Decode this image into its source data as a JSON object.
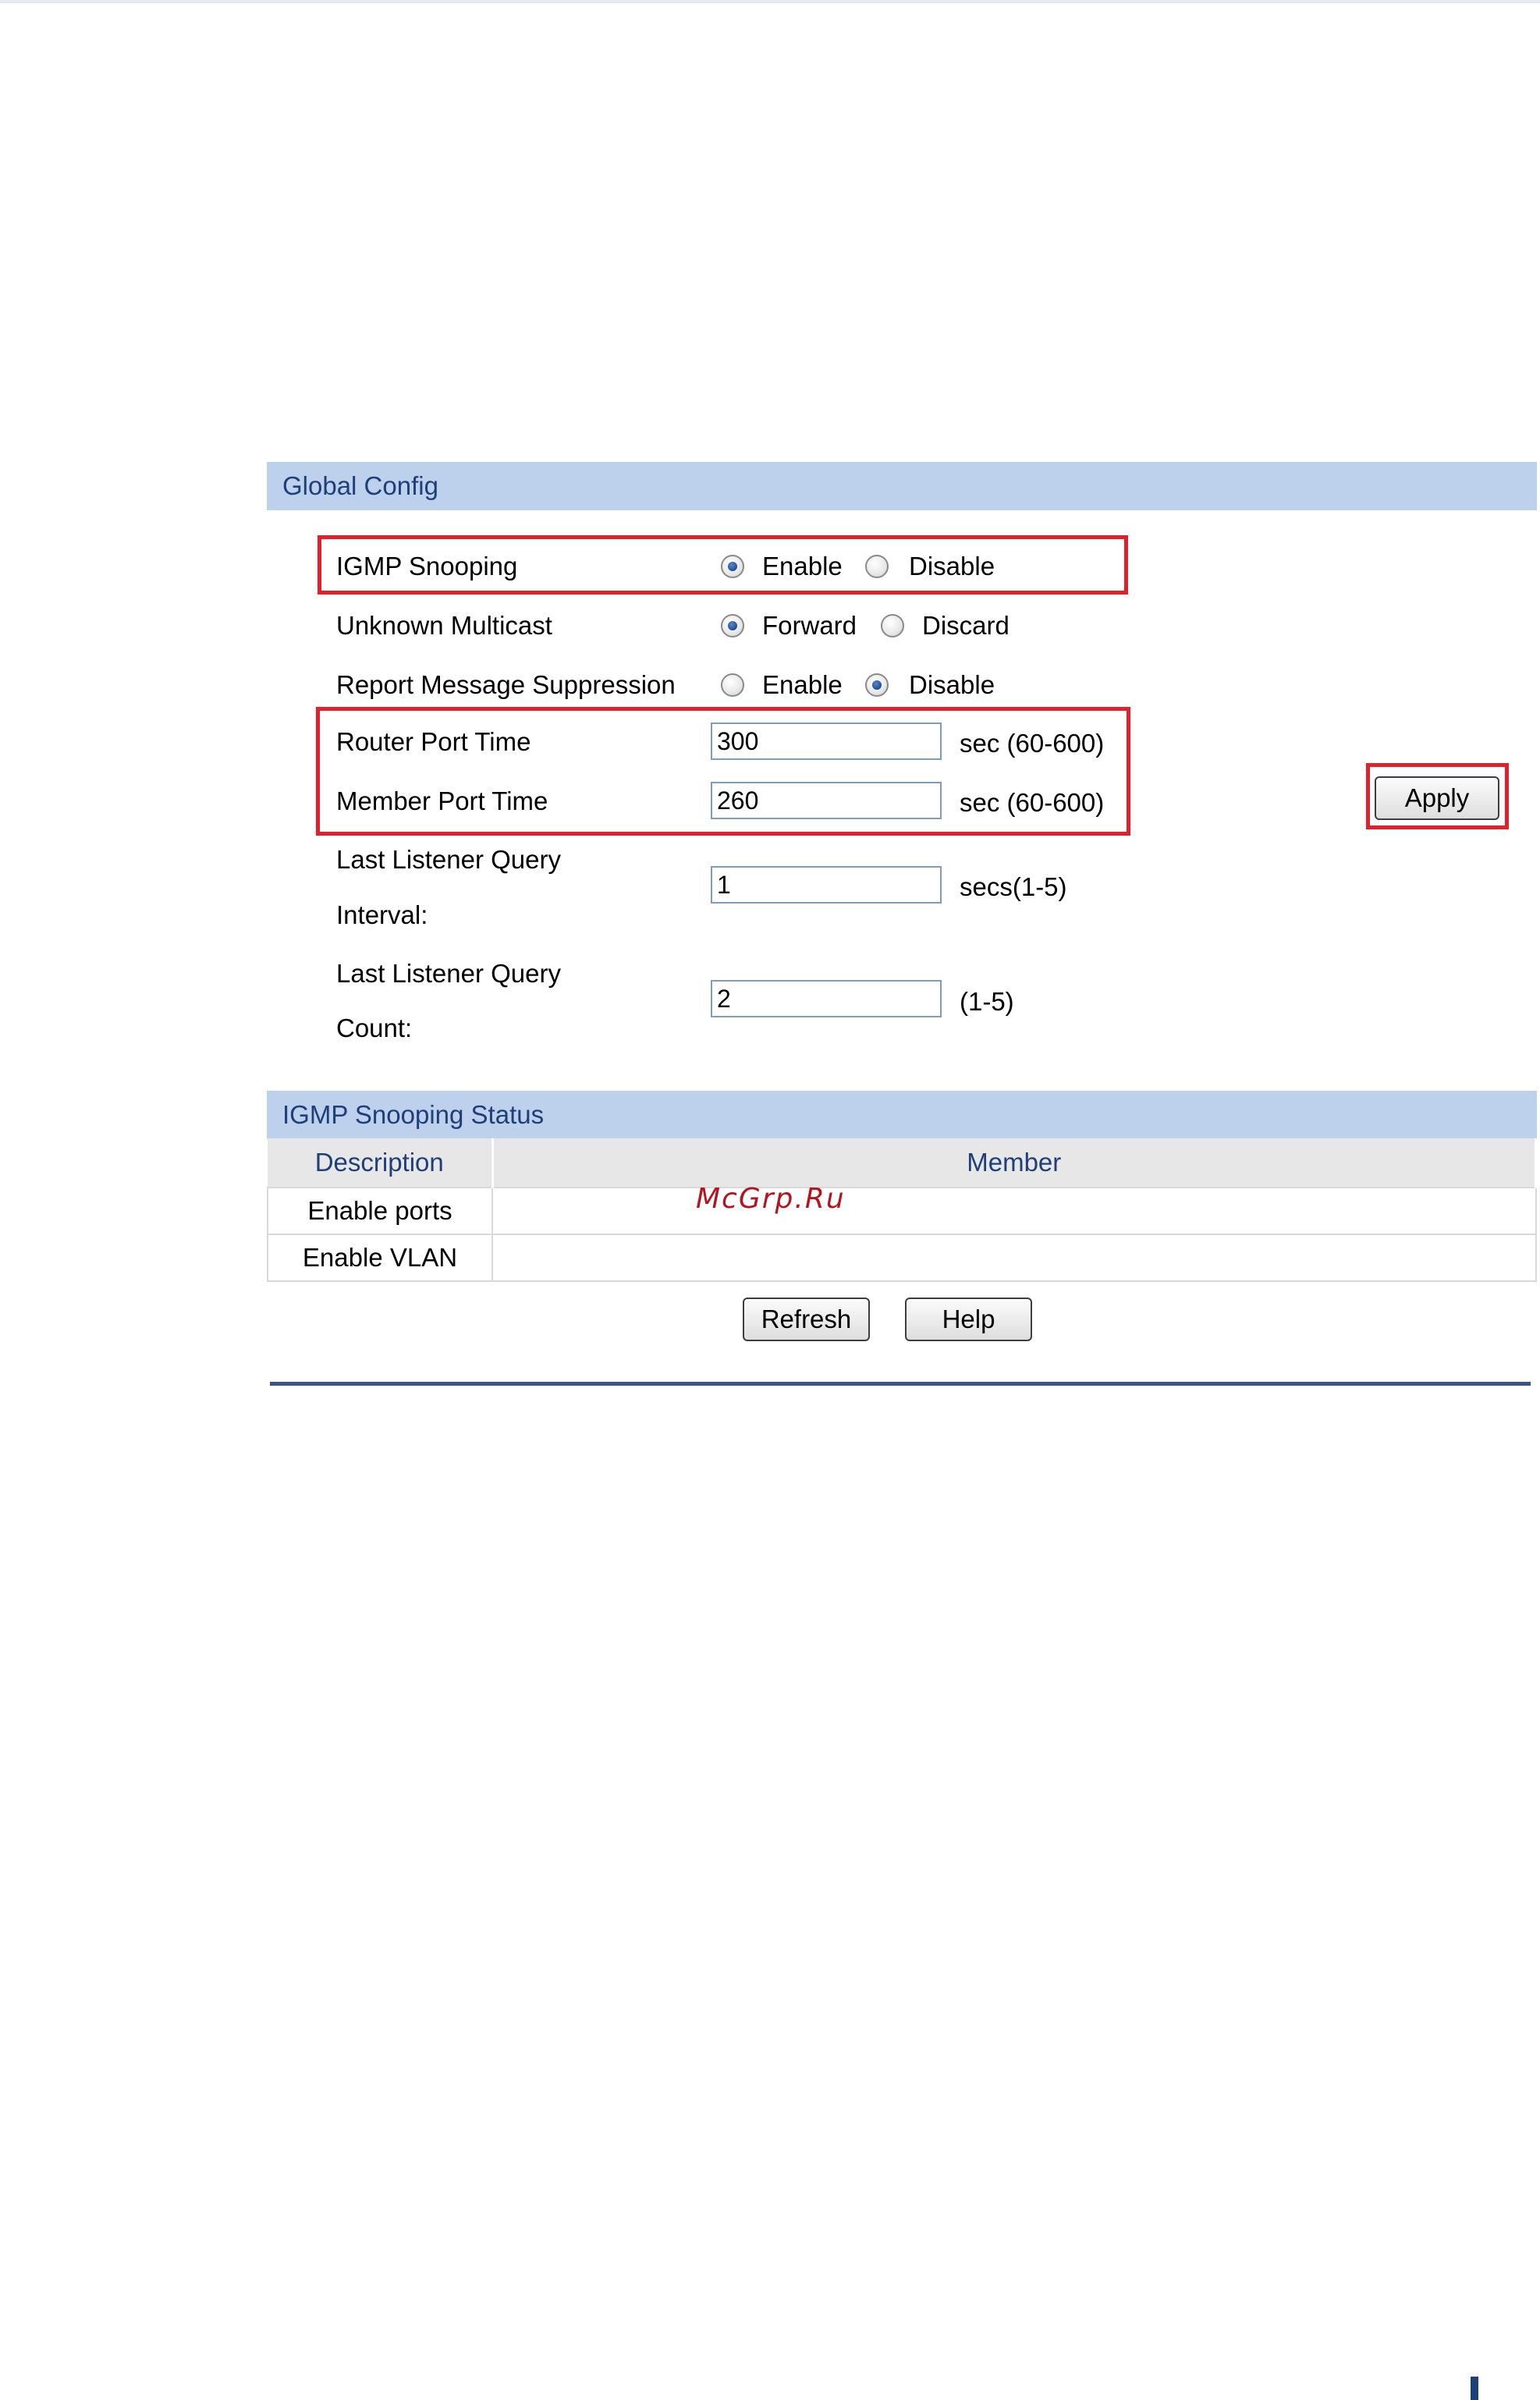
{
  "global_config": {
    "title": "Global Config",
    "igmp_snooping": {
      "label": "IGMP Snooping",
      "options": [
        "Enable",
        "Disable"
      ],
      "selected": "Enable"
    },
    "unknown_multicast": {
      "label": "Unknown Multicast",
      "options": [
        "Forward",
        "Discard"
      ],
      "selected": "Forward"
    },
    "report_message_suppression": {
      "label": "Report Message Suppression",
      "options": [
        "Enable",
        "Disable"
      ],
      "selected": "Disable"
    },
    "router_port_time": {
      "label": "Router Port Time",
      "value": "300",
      "unit": "sec (60-600)"
    },
    "member_port_time": {
      "label": "Member Port Time",
      "value": "260",
      "unit": "sec (60-600)"
    },
    "last_listener_query_interval": {
      "label_line1": "Last Listener Query",
      "label_line2": "Interval:",
      "value": "1",
      "unit": "secs(1-5)"
    },
    "last_listener_query_count": {
      "label_line1": "Last Listener Query",
      "label_line2": "Count:",
      "value": "2",
      "unit": "(1-5)"
    },
    "apply_label": "Apply"
  },
  "status": {
    "title": "IGMP Snooping Status",
    "columns": [
      "Description",
      "Member"
    ],
    "rows": [
      {
        "description": "Enable ports",
        "member": ""
      },
      {
        "description": "Enable VLAN",
        "member": ""
      }
    ]
  },
  "buttons": {
    "refresh": "Refresh",
    "help": "Help"
  },
  "watermark": "McGrp.Ru",
  "colors": {
    "section_bar": "#bdd1ec",
    "section_text": "#1f3f7a",
    "highlight": "#e2202c",
    "rule": "#3a5488"
  }
}
